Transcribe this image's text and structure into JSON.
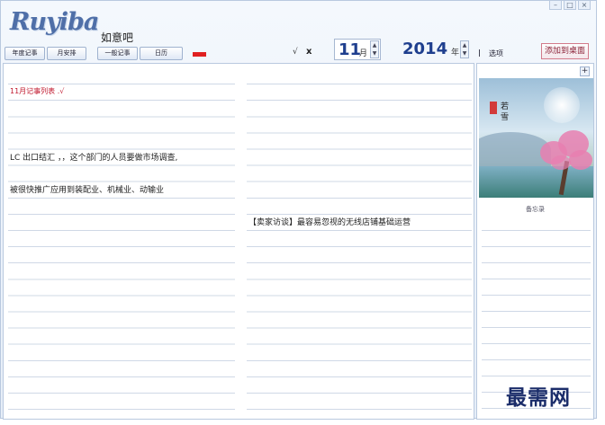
{
  "app": {
    "logo": "Ruyiba",
    "name": "如意吧",
    "window_controls": [
      "–",
      "□",
      "×"
    ]
  },
  "toolbar": {
    "tabs": [
      "年度记事",
      "月安排",
      "一般记事",
      "日历"
    ],
    "check_label": "√",
    "close_label": "x",
    "month_value": "11",
    "month_unit": "月",
    "year_value": "2014",
    "year_unit": "年",
    "spin_up": "▲",
    "spin_down": "▼",
    "options_label": "选项",
    "add_to_desktop": "添加到桌面"
  },
  "notes": {
    "left": [
      {
        "text": "11月记事列表 .√",
        "style": "red",
        "line": 2
      },
      {
        "text": "LC 出口结汇 ，，这个部门的人员要做市场调查,",
        "style": "normal",
        "line": 6
      },
      {
        "text": "被很快推广应用到装配业、机械业、动输业",
        "style": "normal",
        "line": 8
      }
    ],
    "right": [
      {
        "text": "【卖家访谈】最容易忽视的无线店铺基础运营",
        "style": "normal",
        "line": 10
      }
    ]
  },
  "sidebar": {
    "add_button": "+",
    "memo_label": "备忘录",
    "picture_text": [
      "若",
      "雪"
    ]
  },
  "watermark": "最需网"
}
